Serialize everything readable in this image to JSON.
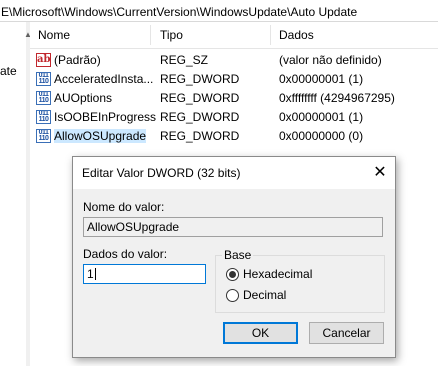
{
  "address_path": "E\\Microsoft\\Windows\\CurrentVersion\\WindowsUpdate\\Auto Update",
  "tree": {
    "fragment": "ate"
  },
  "columns": {
    "name": "Nome",
    "type": "Tipo",
    "data": "Dados"
  },
  "rows": [
    {
      "name": "(Padrão)",
      "type": "REG_SZ",
      "data": "(valor não definido)",
      "icon": "string-value-icon"
    },
    {
      "name": "AcceleratedInsta...",
      "type": "REG_DWORD",
      "data": "0x00000001 (1)",
      "icon": "dword-value-icon"
    },
    {
      "name": "AUOptions",
      "type": "REG_DWORD",
      "data": "0xffffffff (4294967295)",
      "icon": "dword-value-icon"
    },
    {
      "name": "IsOOBEInProgress",
      "type": "REG_DWORD",
      "data": "0x00000001 (1)",
      "icon": "dword-value-icon"
    },
    {
      "name": "AllowOSUpgrade",
      "type": "REG_DWORD",
      "data": "0x00000000 (0)",
      "icon": "dword-value-icon"
    }
  ],
  "dialog": {
    "title": "Editar Valor DWORD (32 bits)",
    "close": "✕",
    "value_name_label": "Nome do valor:",
    "value_name": "AllowOSUpgrade",
    "value_data_label": "Dados do valor:",
    "value_data": "1",
    "base_label": "Base",
    "hex_label": "Hexadecimal",
    "dec_label": "Decimal",
    "selected_base": "Hexadecimal",
    "ok": "OK",
    "cancel": "Cancelar"
  },
  "colors": {
    "accent": "#0078d7",
    "selection": "#cce8ff",
    "dialog_bg": "#f0f0f0"
  }
}
